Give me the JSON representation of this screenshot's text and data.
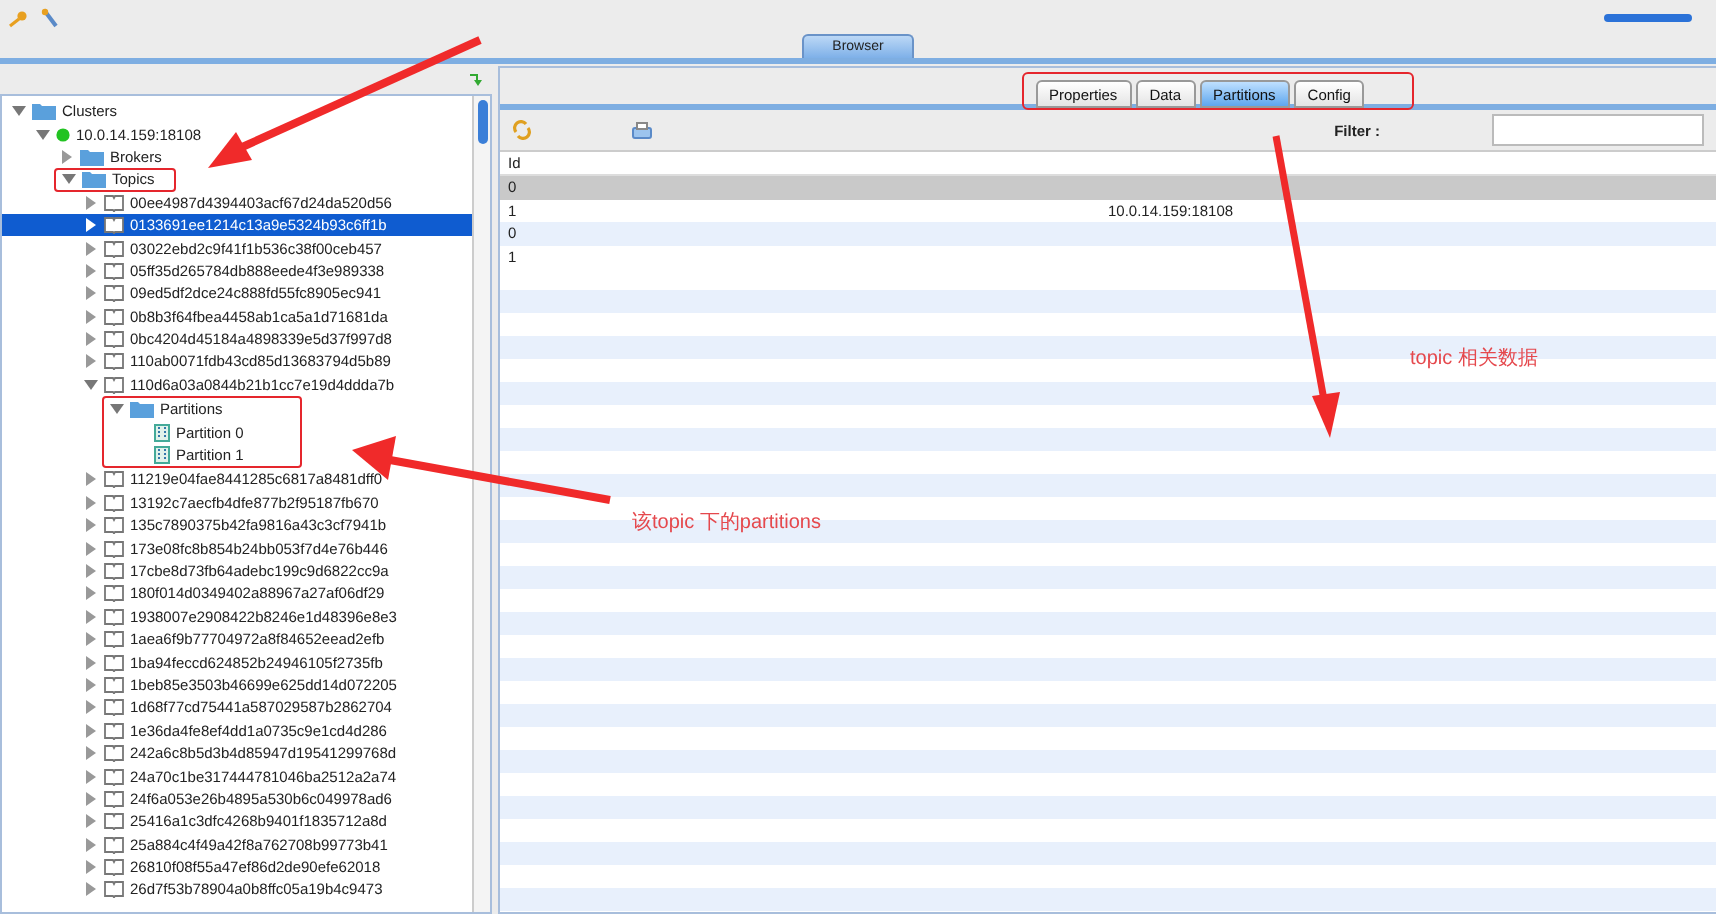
{
  "browser_tab": {
    "label": "Browser",
    "selected": true
  },
  "tree": [
    {
      "label": "Clusters",
      "kind": "folder",
      "expanded": true,
      "selected": false,
      "children": [
        {
          "label": "10.0.14.159:18108",
          "kind": "server",
          "expanded": true,
          "selected": false,
          "children": [
            {
              "label": "Brokers",
              "kind": "folder",
              "expanded": false,
              "selected": false
            },
            {
              "label": "Topics",
              "kind": "folder",
              "expanded": true,
              "selected": false,
              "row_highlighted": true,
              "children": [
                {
                  "label": "00ee4987d4394403acf67d24da520d56",
                  "kind": "topic",
                  "expanded": false,
                  "selected": false
                },
                {
                  "label": "0133691ee1214c13a9e5324b93c6ff1b",
                  "kind": "topic",
                  "expanded": false,
                  "selected": true
                },
                {
                  "label": "03022ebd2c9f41f1b536c38f00ceb457",
                  "kind": "topic",
                  "expanded": false,
                  "selected": false
                },
                {
                  "label": "05ff35d265784db888eede4f3e989338",
                  "kind": "topic",
                  "expanded": false,
                  "selected": false
                },
                {
                  "label": "09ed5df2dce24c888fd55fc8905ec941",
                  "kind": "topic",
                  "expanded": false,
                  "selected": false
                },
                {
                  "label": "0b8b3f64fbea4458ab1ca5a1d71681da",
                  "kind": "topic",
                  "expanded": false,
                  "selected": false
                },
                {
                  "label": "0bc4204d45184a4898339e5d37f997d8",
                  "kind": "topic",
                  "expanded": false,
                  "selected": false
                },
                {
                  "label": "110ab0071fdb43cd85d13683794d5b89",
                  "kind": "topic",
                  "expanded": false,
                  "selected": false
                },
                {
                  "label": "110d6a03a0844b21b1cc7e19d4ddda7b",
                  "kind": "topic",
                  "expanded": true,
                  "selected": false,
                  "children": [
                    {
                      "label": "Partitions",
                      "kind": "folder",
                      "expanded": true,
                      "selected": false,
                      "subtree_highlighted": true,
                      "children": [
                        {
                          "label": "Partition 0",
                          "kind": "partition",
                          "selected": false
                        },
                        {
                          "label": "Partition 1",
                          "kind": "partition",
                          "selected": false
                        }
                      ]
                    }
                  ]
                },
                {
                  "label": "11219e04fae8441285c6817a8481dff0",
                  "kind": "topic",
                  "expanded": false,
                  "selected": false
                },
                {
                  "label": "13192c7aecfb4dfe877b2f95187fb670",
                  "kind": "topic",
                  "expanded": false,
                  "selected": false
                },
                {
                  "label": "135c7890375b42fa9816a43c3cf7941b",
                  "kind": "topic",
                  "expanded": false,
                  "selected": false
                },
                {
                  "label": "173e08fc8b854b24bb053f7d4e76b446",
                  "kind": "topic",
                  "expanded": false,
                  "selected": false
                },
                {
                  "label": "17cbe8d73fb64adebc199c9d6822cc9a",
                  "kind": "topic",
                  "expanded": false,
                  "selected": false
                },
                {
                  "label": "180f014d0349402a88967a27af06df29",
                  "kind": "topic",
                  "expanded": false,
                  "selected": false
                },
                {
                  "label": "1938007e2908422b8246e1d48396e8e3",
                  "kind": "topic",
                  "expanded": false,
                  "selected": false
                },
                {
                  "label": "1aea6f9b77704972a8f84652eead2efb",
                  "kind": "topic",
                  "expanded": false,
                  "selected": false
                },
                {
                  "label": "1ba94feccd624852b24946105f2735fb",
                  "kind": "topic",
                  "expanded": false,
                  "selected": false
                },
                {
                  "label": "1beb85e3503b46699e625dd14d072205",
                  "kind": "topic",
                  "expanded": false,
                  "selected": false
                },
                {
                  "label": "1d68f77cd75441a587029587b2862704",
                  "kind": "topic",
                  "expanded": false,
                  "selected": false
                },
                {
                  "label": "1e36da4fe8ef4dd1a0735c9e1cd4d286",
                  "kind": "topic",
                  "expanded": false,
                  "selected": false
                },
                {
                  "label": "242a6c8b5d3b4d85947d19541299768d",
                  "kind": "topic",
                  "expanded": false,
                  "selected": false
                },
                {
                  "label": "24a70c1be317444781046ba2512a2a74",
                  "kind": "topic",
                  "expanded": false,
                  "selected": false
                },
                {
                  "label": "24f6a053e26b4895a530b6c049978ad6",
                  "kind": "topic",
                  "expanded": false,
                  "selected": false
                },
                {
                  "label": "25416a1c3dfc4268b9401f1835712a8d",
                  "kind": "topic",
                  "expanded": false,
                  "selected": false
                },
                {
                  "label": "25a884c4f49a42f8a762708b99773b41",
                  "kind": "topic",
                  "expanded": false,
                  "selected": false
                },
                {
                  "label": "26810f08f55a47ef86d2de90efe62018",
                  "kind": "topic",
                  "expanded": false,
                  "selected": false
                },
                {
                  "label": "26d7f53b78904a0b8ffc05a19b4c9473",
                  "kind": "topic",
                  "expanded": false,
                  "selected": false
                }
              ]
            }
          ]
        }
      ]
    }
  ],
  "detail_tabs_highlighted": true,
  "detail_tabs": [
    {
      "label": "Properties",
      "selected": false
    },
    {
      "label": "Data",
      "selected": false
    },
    {
      "label": "Partitions",
      "selected": true
    },
    {
      "label": "Config",
      "selected": false
    }
  ],
  "filter": {
    "label": "Filter :"
  },
  "table": {
    "columns": [
      "Id"
    ],
    "rows": [
      {
        "id": "0",
        "leader": "",
        "selected": true
      },
      {
        "id": "1",
        "leader": "10.0.14.159:18108",
        "selected": false
      },
      {
        "id": "0",
        "leader": "",
        "selected": false
      },
      {
        "id": "1",
        "leader": "",
        "selected": false
      }
    ]
  },
  "annotations": [
    "topic 相关数据",
    "该topic 下的partitions"
  ]
}
